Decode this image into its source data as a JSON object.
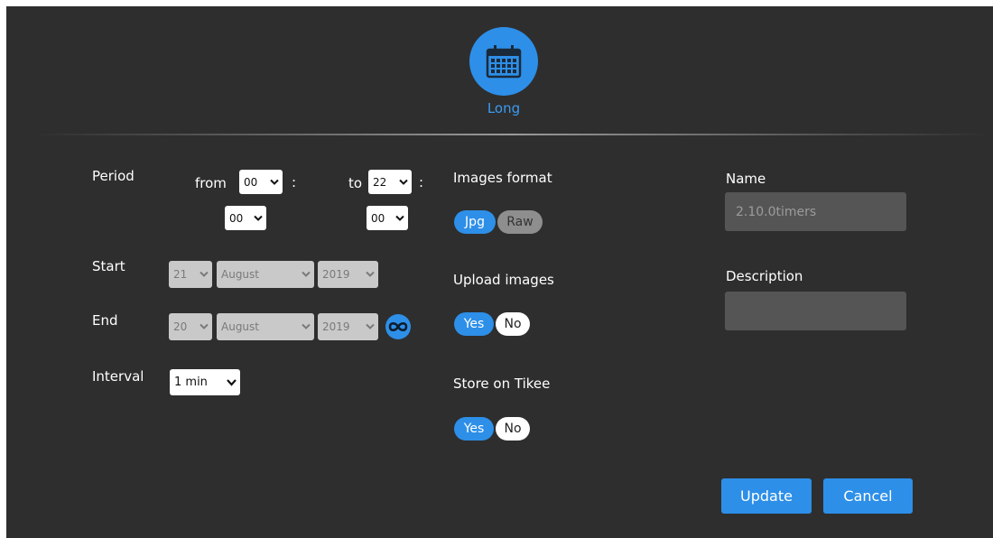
{
  "header": {
    "mode_label": "Long",
    "icon": "calendar-icon"
  },
  "period": {
    "label": "Period",
    "from_label": "from",
    "to_label": "to",
    "separator": ":",
    "from_hour": "00",
    "from_minute": "00",
    "to_hour": "22",
    "to_minute": "00"
  },
  "start": {
    "label": "Start",
    "day": "21",
    "month": "August",
    "year": "2019"
  },
  "end": {
    "label": "End",
    "day": "20",
    "month": "August",
    "year": "2019",
    "infinity_icon": "infinity-icon"
  },
  "interval": {
    "label": "Interval",
    "value": "1 min"
  },
  "images_format": {
    "label": "Images format",
    "options": [
      "Jpg",
      "Raw"
    ],
    "selected": "Jpg"
  },
  "upload_images": {
    "label": "Upload images",
    "yes": "Yes",
    "no": "No",
    "selected": "Yes"
  },
  "store_on_tikee": {
    "label": "Store on Tikee",
    "yes": "Yes",
    "no": "No",
    "selected": "Yes"
  },
  "name": {
    "label": "Name",
    "value": "2.10.0timers"
  },
  "description": {
    "label": "Description",
    "value": ""
  },
  "buttons": {
    "update": "Update",
    "cancel": "Cancel"
  },
  "colors": {
    "accent": "#2d8fe8",
    "panel_bg": "#2e2e2e",
    "input_bg": "#555555"
  }
}
